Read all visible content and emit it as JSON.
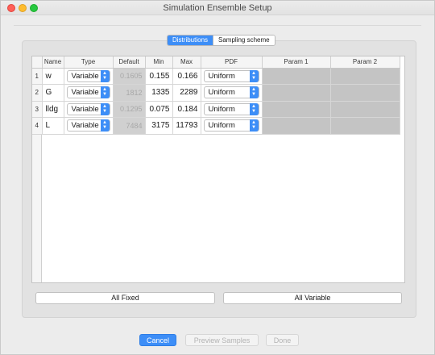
{
  "window": {
    "title": "Simulation Ensemble Setup"
  },
  "tabs": [
    {
      "label": "Distributions",
      "active": true
    },
    {
      "label": "Sampling scheme",
      "active": false
    }
  ],
  "table": {
    "headers": [
      "Name",
      "Type",
      "Default",
      "Min",
      "Max",
      "PDF",
      "Param 1",
      "Param 2"
    ],
    "rows": [
      {
        "num": "1",
        "name": "w",
        "type": "Variable",
        "default": "0.1605",
        "min": "0.155",
        "max": "0.166",
        "pdf": "Uniform"
      },
      {
        "num": "2",
        "name": "G",
        "type": "Variable",
        "default": "1812",
        "min": "1335",
        "max": "2289",
        "pdf": "Uniform"
      },
      {
        "num": "3",
        "name": "lldg",
        "type": "Variable",
        "default": "0.1295",
        "min": "0.075",
        "max": "0.184",
        "pdf": "Uniform"
      },
      {
        "num": "4",
        "name": "L",
        "type": "Variable",
        "default": "7484",
        "min": "3175",
        "max": "11793",
        "pdf": "Uniform"
      }
    ]
  },
  "actions": {
    "all_fixed": "All Fixed",
    "all_variable": "All Variable"
  },
  "footer": {
    "cancel": "Cancel",
    "preview": "Preview Samples",
    "done": "Done"
  },
  "colors": {
    "accent": "#3d8ef7",
    "disabled_cell": "#d0d0d0",
    "param_cell": "#c4c4c4"
  }
}
